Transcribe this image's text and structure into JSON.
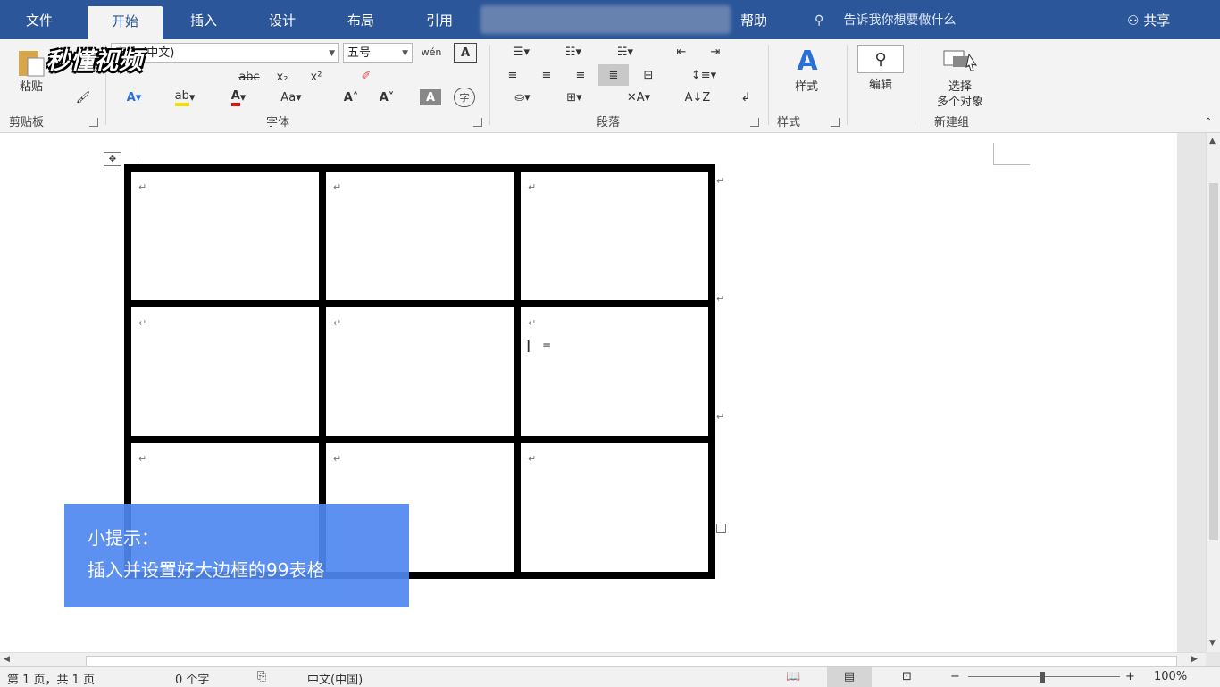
{
  "tabs": [
    "文件",
    "开始",
    "插入",
    "设计",
    "布局",
    "引用",
    "帮助"
  ],
  "active_tab": "开始",
  "tell_me": "告诉我你想要做什么",
  "share_label": "共享",
  "ribbon": {
    "paste_label": "粘贴",
    "clipboard_label": "剪贴板",
    "font_name": "宋体 (中文)",
    "font_size": "五号",
    "font_label": "字体",
    "paragraph_label": "段落",
    "styles_btn": "样式",
    "styles_label": "样式",
    "edit_btn": "编辑",
    "select_btn_1": "选择",
    "select_btn_2": "多个对象",
    "newgroup_label": "新建组",
    "strike_label": "abc",
    "case_label": "Aa",
    "font_color_label": "A",
    "wen_label": "wén",
    "char_label": "字"
  },
  "table": {
    "rows": 3,
    "cols": 3,
    "para_mark": "↵"
  },
  "status": {
    "page": "第 1 页，共 1 页",
    "words": "0 个字",
    "lang": "中文(中国)",
    "zoom": "100%"
  },
  "tip": {
    "title": "小提示：",
    "body": "插入并设置好大边框的99表格"
  },
  "watermark": "秒懂视频"
}
